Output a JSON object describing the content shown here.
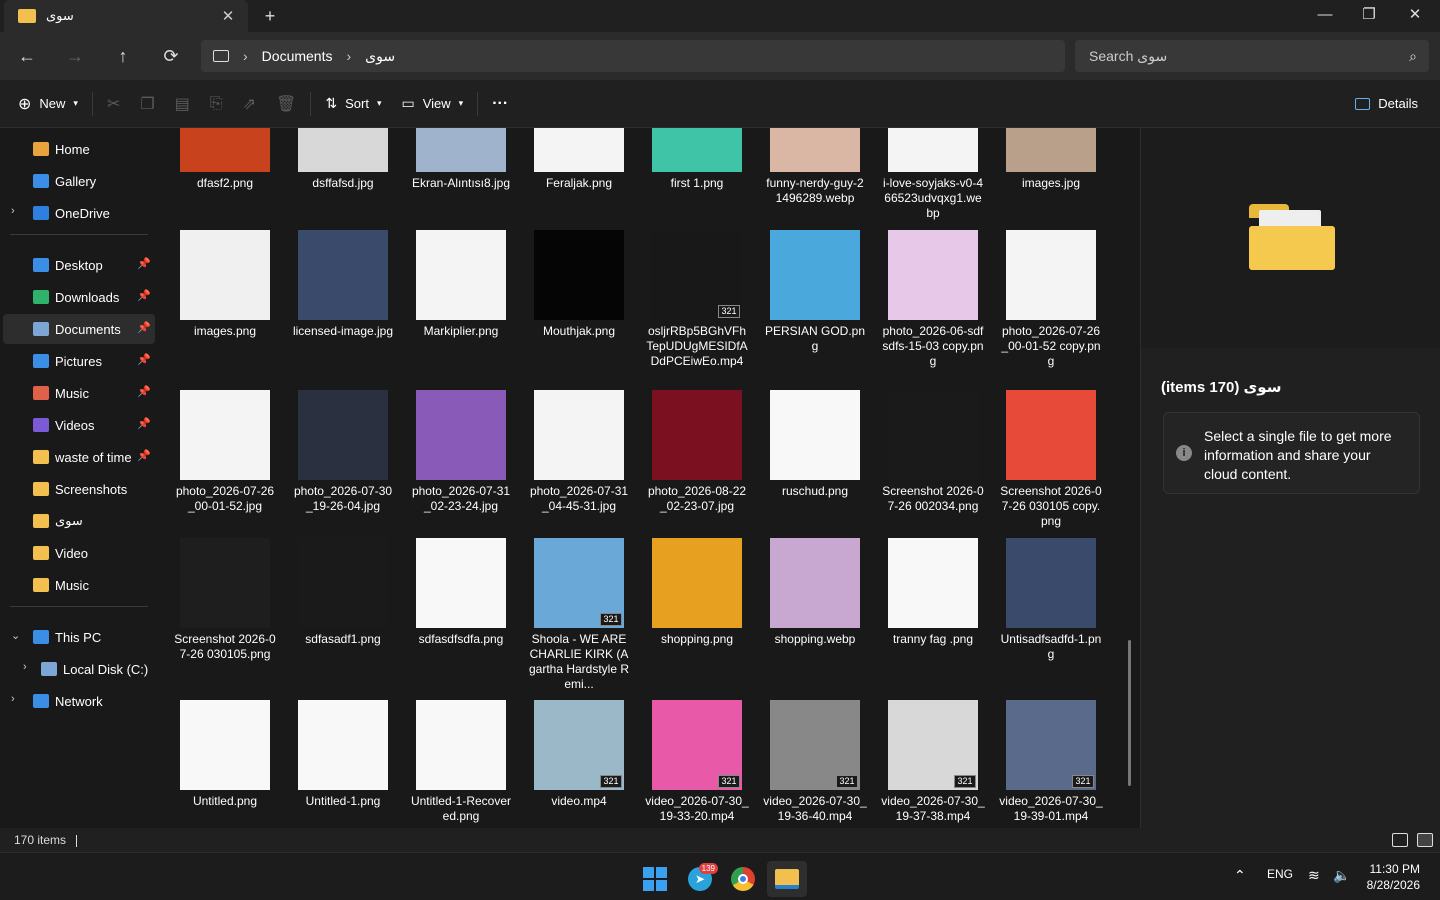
{
  "window": {
    "tab_title": "سوی",
    "new_tab": "+",
    "close_tab": "✕",
    "minimize": "—",
    "maximize": "❐",
    "close": "✕"
  },
  "nav": {
    "back": "←",
    "forward": "→",
    "up": "↑",
    "refresh": "⟳",
    "breadcrumb": [
      "Documents",
      "سوی"
    ],
    "search_placeholder": "Search سوی"
  },
  "commands": {
    "new": "New",
    "sort": "Sort",
    "view": "View",
    "more": "···",
    "details": "Details"
  },
  "sidebar": {
    "top": [
      {
        "label": "Home",
        "icon": "home-icon",
        "color": "#e8a33c"
      },
      {
        "label": "Gallery",
        "icon": "gallery-icon",
        "color": "#3a8ee6"
      },
      {
        "label": "OneDrive",
        "icon": "cloud-icon",
        "color": "#2f7fe0"
      }
    ],
    "pinned": [
      {
        "label": "Desktop",
        "icon": "desktop-icon",
        "color": "#3a8ee6",
        "pinned": true
      },
      {
        "label": "Downloads",
        "icon": "download-icon",
        "color": "#2fb36a",
        "pinned": true
      },
      {
        "label": "Documents",
        "icon": "documents-icon",
        "color": "#7da6d6",
        "pinned": true,
        "selected": true
      },
      {
        "label": "Pictures",
        "icon": "pictures-icon",
        "color": "#3a8ee6",
        "pinned": true
      },
      {
        "label": "Music",
        "icon": "music-icon",
        "color": "#e0614a",
        "pinned": true
      },
      {
        "label": "Videos",
        "icon": "videos-icon",
        "color": "#7a5ad6",
        "pinned": true
      },
      {
        "label": "waste of time",
        "icon": "folder-icon",
        "color": "#f2c04e",
        "pinned": true
      },
      {
        "label": "Screenshots",
        "icon": "folder-icon",
        "color": "#f2c04e",
        "pinned": false
      },
      {
        "label": "سوی",
        "icon": "folder-icon",
        "color": "#f2c04e",
        "pinned": false
      },
      {
        "label": "Video",
        "icon": "folder-icon",
        "color": "#f2c04e",
        "pinned": false
      },
      {
        "label": "Music",
        "icon": "folder-icon",
        "color": "#f2c04e",
        "pinned": false
      }
    ],
    "bottom": [
      {
        "label": "This PC",
        "icon": "pc-icon",
        "color": "#3a8ee6",
        "expanded": true
      },
      {
        "label": "Local Disk (C:)",
        "icon": "drive-icon",
        "color": "#7da6d6"
      },
      {
        "label": "Network",
        "icon": "network-icon",
        "color": "#3a8ee6"
      }
    ]
  },
  "files": [
    {
      "name": "dfasf2.png",
      "color": "#c8421e"
    },
    {
      "name": "dsffafsd.jpg",
      "color": "#d8d8d8"
    },
    {
      "name": "Ekran-Alıntısı8.jpg",
      "color": "#9fb4cc"
    },
    {
      "name": "Feraljak.png",
      "color": "#f4f4f4"
    },
    {
      "name": "first 1.png",
      "color": "#3fc4a8"
    },
    {
      "name": "funny-nerdy-guy-21496289.webp",
      "color": "#d9b7a4"
    },
    {
      "name": "i-love-soyjaks-v0-466523udvqxg1.webp",
      "color": "#f4f4f4"
    },
    {
      "name": "images.jpg",
      "color": "#b8a08a"
    },
    {
      "name": "images.png",
      "color": "#f0f0f0"
    },
    {
      "name": "licensed-image.jpg",
      "color": "#3a4a6a"
    },
    {
      "name": "Markiplier.png",
      "color": "#f4f4f4"
    },
    {
      "name": "Mouthjak.png",
      "color": "#050505"
    },
    {
      "name": "osljrRBp5BGhVFhTepUDUgMESIDfADdPCEiwEo.mp4",
      "color": "#181818",
      "video": true
    },
    {
      "name": "PERSIAN GOD.png",
      "color": "#4aa8dc"
    },
    {
      "name": "photo_2026-06-sdfsdfs-15-03 copy.png",
      "color": "#e8c8e8"
    },
    {
      "name": "photo_2026-07-26_00-01-52 copy.png",
      "color": "#f4f4f4"
    },
    {
      "name": "photo_2026-07-26_00-01-52.jpg",
      "color": "#f4f4f4"
    },
    {
      "name": "photo_2026-07-30_19-26-04.jpg",
      "color": "#2a3040"
    },
    {
      "name": "photo_2026-07-31_02-23-24.jpg",
      "color": "#8a5ab8"
    },
    {
      "name": "photo_2026-07-31_04-45-31.jpg",
      "color": "#f4f4f4"
    },
    {
      "name": "photo_2026-08-22_02-23-07.jpg",
      "color": "#7a1020"
    },
    {
      "name": "ruschud.png",
      "color": "#f8f8f8"
    },
    {
      "name": "Screenshot 2026-07-26 002034.png",
      "color": "#1a1a1a"
    },
    {
      "name": "Screenshot 2026-07-26 030105 copy.png",
      "color": "#e84a3a"
    },
    {
      "name": "Screenshot 2026-07-26 030105.png",
      "color": "#1e1e1e"
    },
    {
      "name": "sdfasadf1.png",
      "color": "#1a1a1a"
    },
    {
      "name": "sdfasdfsdfa.png",
      "color": "#f8f8f8"
    },
    {
      "name": "Shoola - WE ARE CHARLIE KIRK (Agartha Hardstyle Remi...",
      "color": "#6aa8d8",
      "video": true
    },
    {
      "name": "shopping.png",
      "color": "#e8a020"
    },
    {
      "name": "shopping.webp",
      "color": "#c8a8d0"
    },
    {
      "name": "tranny fag .png",
      "color": "#f8f8f8"
    },
    {
      "name": "Untisadfsadfd-1.png",
      "color": "#3a4a6a"
    },
    {
      "name": "Untitled.png",
      "color": "#f8f8f8"
    },
    {
      "name": "Untitled-1.png",
      "color": "#f8f8f8"
    },
    {
      "name": "Untitled-1-Recovered.png",
      "color": "#f8f8f8"
    },
    {
      "name": "video.mp4",
      "color": "#9ab8c8",
      "video": true
    },
    {
      "name": "video_2026-07-30_19-33-20.mp4",
      "color": "#e85aa8",
      "video": true
    },
    {
      "name": "video_2026-07-30_19-36-40.mp4",
      "color": "#888888",
      "video": true
    },
    {
      "name": "video_2026-07-30_19-37-38.mp4",
      "color": "#d8d8d8",
      "video": true
    },
    {
      "name": "video_2026-07-30_19-39-01.mp4",
      "color": "#5a6a8a",
      "video": true
    }
  ],
  "details_pane": {
    "title": "سوی (170 items)",
    "info_text": "Select a single file to get more information and share your cloud content."
  },
  "status": {
    "count": "170 items"
  },
  "taskbar": {
    "telegram_badge": "139",
    "lang": "ENG",
    "time": "11:30 PM",
    "date": "8/28/2026"
  },
  "video_badge": "321"
}
